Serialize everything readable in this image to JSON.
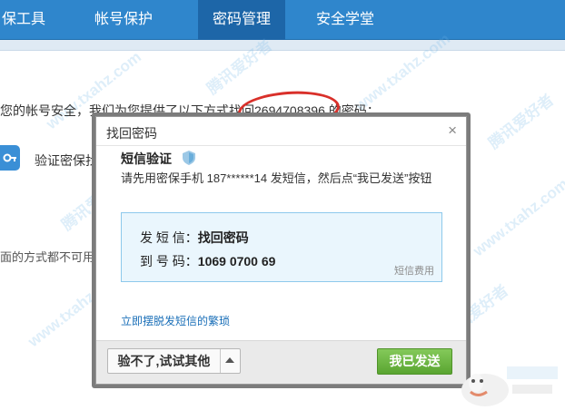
{
  "nav": {
    "items": [
      {
        "label": "保工具",
        "active": false
      },
      {
        "label": "帐号保护",
        "active": false
      },
      {
        "label": "密码管理",
        "active": true
      },
      {
        "label": "安全学堂",
        "active": false
      }
    ]
  },
  "page": {
    "info_text_prefix": "您的帐号安全，我们为您提供了以下方式找回",
    "qq_number": "2694708396",
    "info_text_suffix": "的密码：",
    "verify_partial": "验证密保找",
    "unavailable_partial": "面的方式都不可用"
  },
  "dialog": {
    "title": "找回密码",
    "close_label": "×",
    "sms_heading": "短信验证",
    "instruction": "请先用密保手机 187******14 发短信，然后点“我已发送”按钮",
    "sms_box": {
      "send_label": "发 短 信：",
      "send_value": "找回密码",
      "to_label": "到 号 码：",
      "to_value": "1069 0700 69",
      "fee_note": "短信费用"
    },
    "escape_link": "立即摆脱发短信的繁琐",
    "footer": {
      "other_button": "验不了,试试其他",
      "sent_button": "我已发送"
    }
  },
  "watermark": {
    "text": "www.txahz.com",
    "brand": "腾讯爱好者"
  },
  "colors": {
    "nav_bg": "#2f86cc",
    "nav_active": "#1d66a8",
    "highlight_ellipse": "#d9302a",
    "sms_box_bg": "#eaf6fd",
    "primary_button": "#5aa531",
    "link": "#1a6fb8"
  },
  "icons": {
    "key": "key-icon",
    "shield": "shield-icon",
    "close": "close-icon",
    "caret": "caret-up-icon"
  }
}
